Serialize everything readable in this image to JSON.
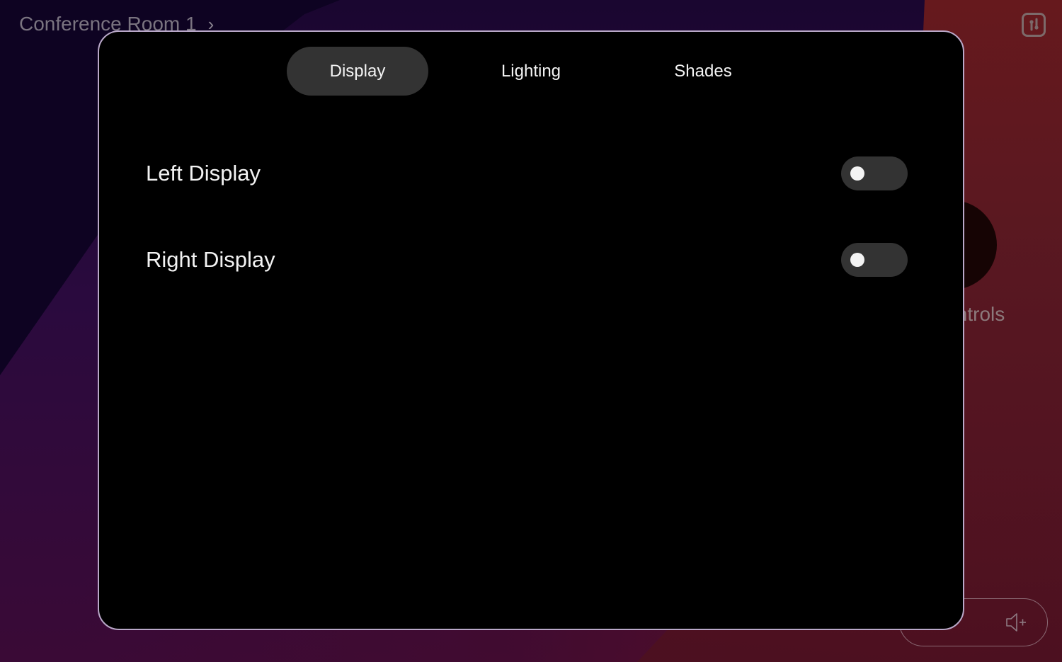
{
  "breadcrumb": {
    "room": "Conference Room 1",
    "chevron": "›"
  },
  "header": {
    "settings_icon": "sliders-icon"
  },
  "background": {
    "controls_label": "Controls",
    "controls_label_visible_fragment": "ontrols",
    "volume_icon": "volume-up-icon"
  },
  "modal": {
    "tabs": [
      {
        "label": "Display",
        "active": true
      },
      {
        "label": "Lighting",
        "active": false
      },
      {
        "label": "Shades",
        "active": false
      }
    ],
    "rows": [
      {
        "label": "Left Display",
        "toggle_on": false
      },
      {
        "label": "Right Display",
        "toggle_on": false
      }
    ]
  },
  "colors": {
    "modal_bg": "#000000",
    "modal_border": "#b9a8c8",
    "active_tab_bg": "#333333",
    "toggle_track": "#333333",
    "toggle_knob": "#f3f3f3",
    "bg_purple": "#1a0630",
    "bg_red": "#6a1a1c"
  }
}
